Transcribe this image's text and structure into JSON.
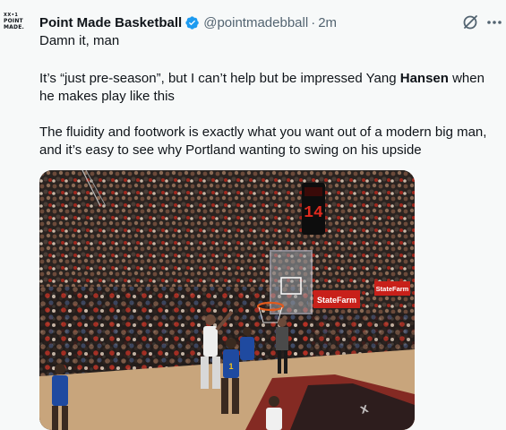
{
  "author": {
    "avatar_lines": [
      "ⅩⅩ•1",
      "POINT",
      "MADE."
    ],
    "name": "Point Made Basketball",
    "handle": "@pointmadebball",
    "separator": "·",
    "time": "2m"
  },
  "tweet": {
    "line1": "Damn it, man",
    "para2_before": "It’s “just pre-season”, but I can’t help but be impressed Yang ",
    "para2_bold": "Hansen",
    "para2_after": " when he makes play like this",
    "para3": "The fluidity and footwork is exactly what you want out of a modern big man, and it’s easy to see why Portland wanting to swing on his upside"
  },
  "media": {
    "shot_clock": "14",
    "arena_sign_1": "StateFarm",
    "arena_sign_2": "StateFarm",
    "jersey_number": "1"
  },
  "colors": {
    "text": "#0f1419",
    "secondary": "#536471",
    "verified": "#1d9bf0",
    "background": "#f7f9f9"
  },
  "icons": [
    "grok-icon",
    "more-icon",
    "verified-icon"
  ]
}
